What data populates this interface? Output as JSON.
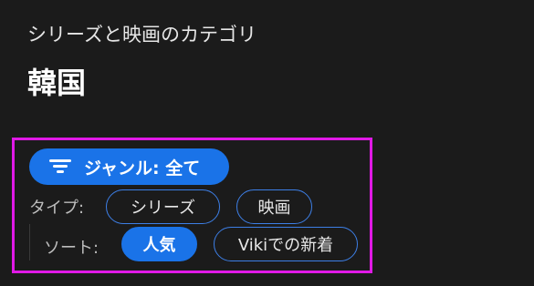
{
  "header": {
    "subtitle": "シリーズと映画のカテゴリ",
    "title": "韓国"
  },
  "filters": {
    "genre_button_label": "ジャンル: 全て",
    "type_label": "タイプ:",
    "type_options": [
      "シリーズ",
      "映画"
    ],
    "sort_label": "ソート:",
    "sort_options": [
      "人気",
      "Vikiでの新着"
    ],
    "selected_sort": "人気"
  },
  "colors": {
    "accent": "#1a73e8",
    "highlight_border": "#e019e6",
    "background": "#1b1b1b"
  }
}
